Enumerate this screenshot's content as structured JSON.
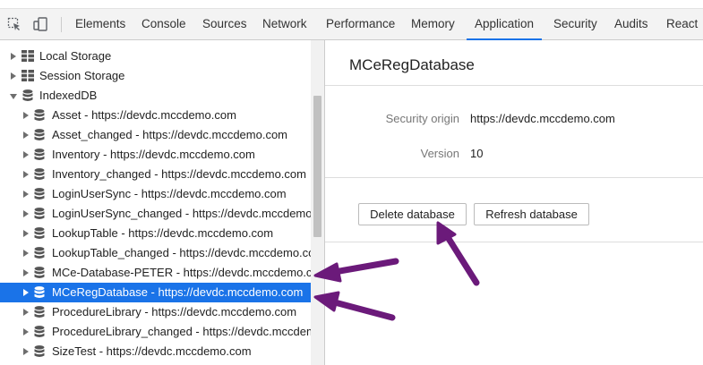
{
  "toolbar": {
    "icons": [
      "inspect-element-icon",
      "device-toolbar-icon"
    ],
    "tabs": [
      "Elements",
      "Console",
      "Sources",
      "Network",
      "Performance",
      "Memory",
      "Application",
      "Security",
      "Audits",
      "React"
    ],
    "active_tab": "Application"
  },
  "sidebar": {
    "local_storage": "Local Storage",
    "session_storage": "Session Storage",
    "indexeddb": "IndexedDB",
    "databases": [
      "Asset - https://devdc.mccdemo.com",
      "Asset_changed - https://devdc.mccdemo.com",
      "Inventory - https://devdc.mccdemo.com",
      "Inventory_changed - https://devdc.mccdemo.com",
      "LoginUserSync - https://devdc.mccdemo.com",
      "LoginUserSync_changed - https://devdc.mccdemo.com",
      "LookupTable - https://devdc.mccdemo.com",
      "LookupTable_changed - https://devdc.mccdemo.com",
      "MCe-Database-PETER - https://devdc.mccdemo.com",
      "MCeRegDatabase - https://devdc.mccdemo.com",
      "ProcedureLibrary - https://devdc.mccdemo.com",
      "ProcedureLibrary_changed - https://devdc.mccdemo.com",
      "SizeTest - https://devdc.mccdemo.com"
    ],
    "selected_index": 9
  },
  "main": {
    "title": "MCeRegDatabase",
    "security_origin_label": "Security origin",
    "security_origin_value": "https://devdc.mccdemo.com",
    "version_label": "Version",
    "version_value": "10",
    "delete_button": "Delete database",
    "refresh_button": "Refresh database"
  },
  "colors": {
    "selection": "#1a73e8",
    "annotation_arrow": "#6b1a7a"
  }
}
